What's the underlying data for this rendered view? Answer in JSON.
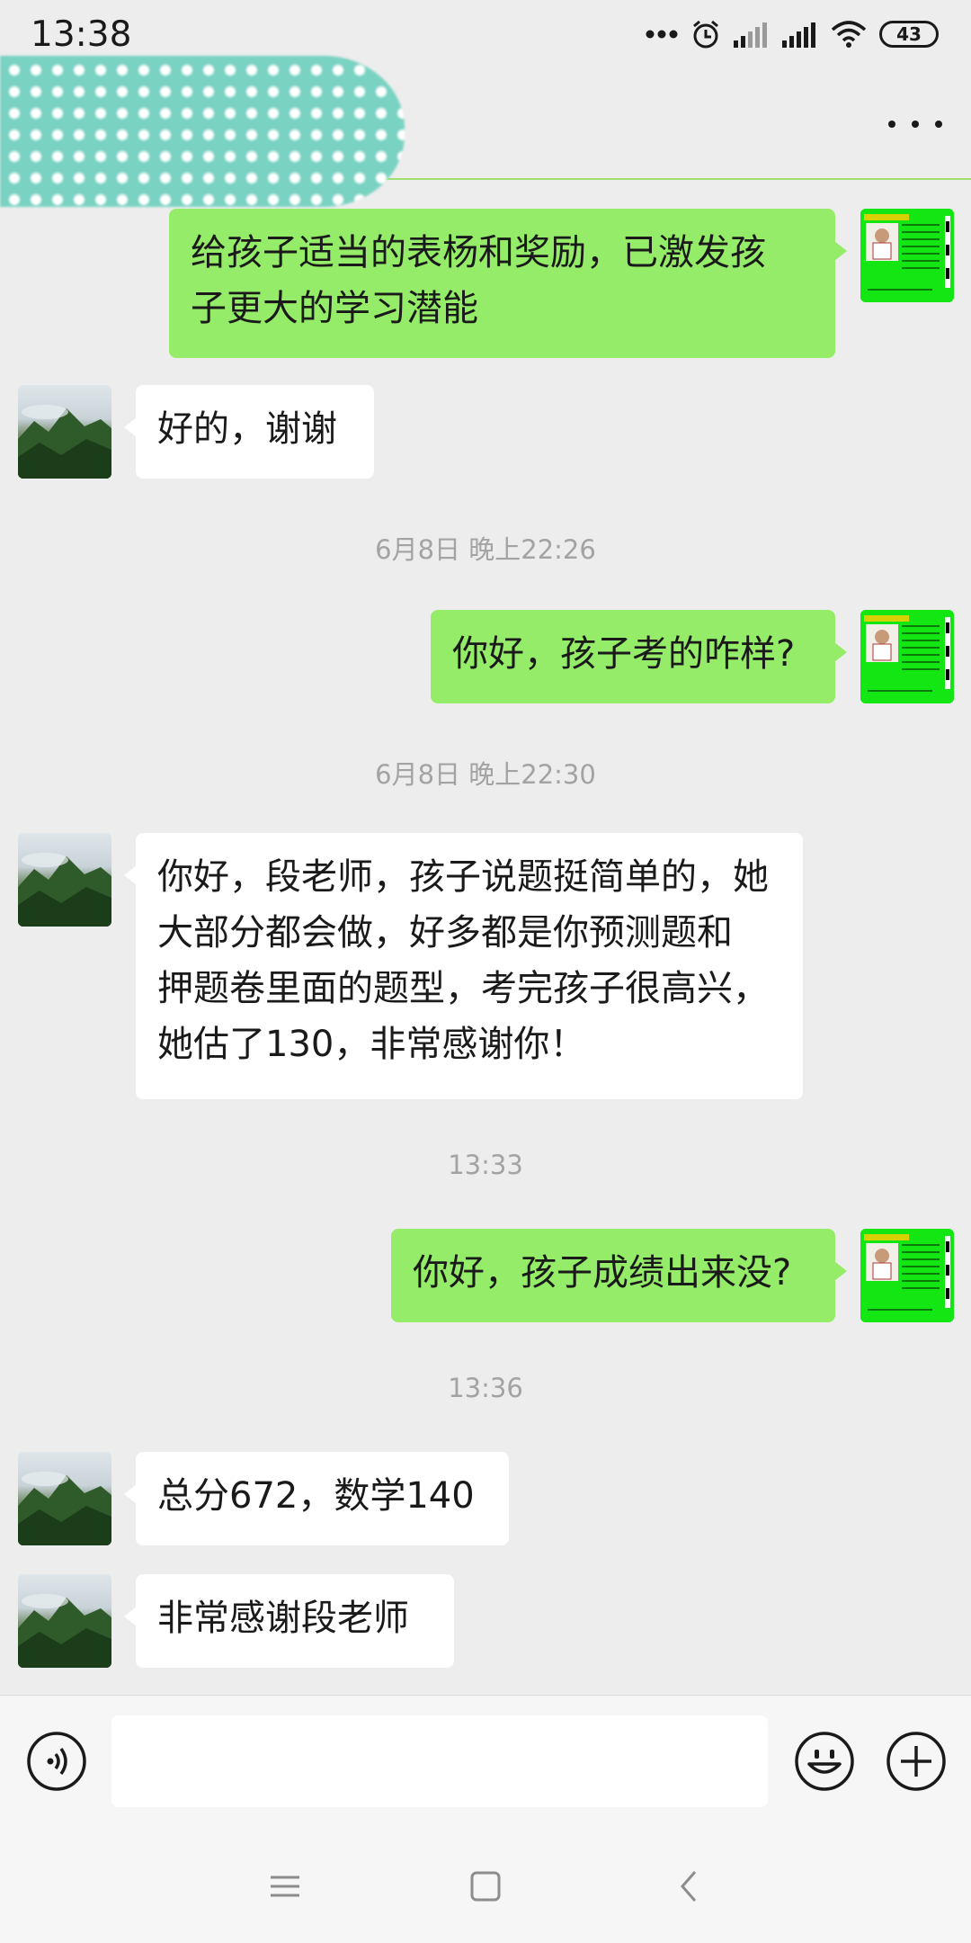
{
  "status_bar": {
    "time": "13:38",
    "battery": "43",
    "icons": [
      "more-dots-icon",
      "alarm-icon",
      "signal-icon",
      "signal-icon",
      "wifi-icon",
      "battery-icon"
    ]
  },
  "header": {
    "title_redacted": true,
    "more_icon": "more-horizontal-icon"
  },
  "messages": [
    {
      "side": "right",
      "text": "给孩子适当的表杨和奖励，已激发孩\n子更大的学习潜能"
    },
    {
      "side": "left",
      "text": "好的，谢谢"
    },
    {
      "type": "time",
      "text": "6月8日 晚上22:26"
    },
    {
      "side": "right",
      "text": "你好，孩子考的咋样?"
    },
    {
      "type": "time",
      "text": "6月8日 晚上22:30"
    },
    {
      "side": "left",
      "text": "你好，段老师，孩子说题挺简单的，她\n大部分都会做，好多都是你预测题和\n押题卷里面的题型，考完孩子很高兴，\n她估了130，非常感谢你！"
    },
    {
      "type": "time",
      "text": "13:33"
    },
    {
      "side": "right",
      "text": "你好，孩子成绩出来没?"
    },
    {
      "type": "time",
      "text": "13:36"
    },
    {
      "side": "left",
      "text": "总分672，数学140"
    },
    {
      "side": "left",
      "text": "非常感谢段老师"
    }
  ],
  "input_bar": {
    "voice_icon": "voice-icon",
    "input_value": "",
    "emoji_icon": "emoji-icon",
    "plus_icon": "plus-icon"
  },
  "nav_bar": {
    "icons": [
      "menu-icon",
      "home-icon",
      "back-icon"
    ]
  },
  "colors": {
    "sent_bubble": "#95ec69",
    "received_bubble": "#ffffff",
    "background": "#ededed",
    "timestamp": "#a3a3a3"
  }
}
